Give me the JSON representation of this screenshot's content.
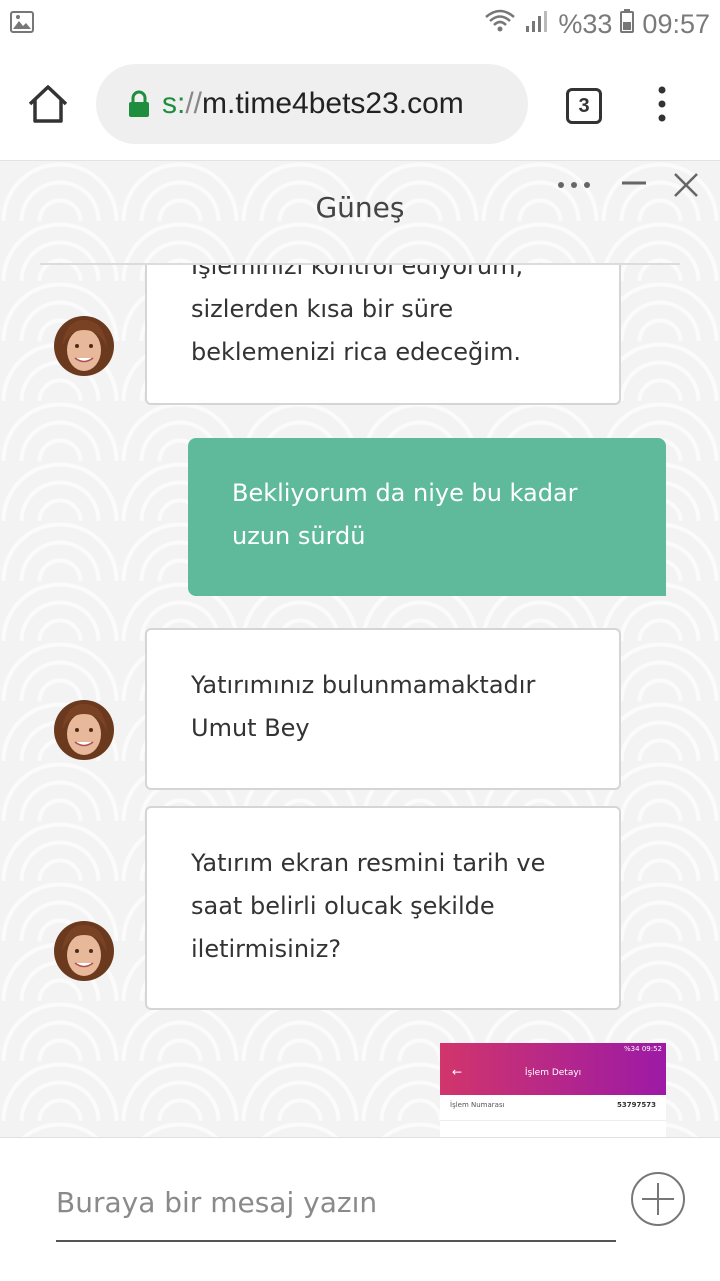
{
  "status_bar": {
    "battery": "%33",
    "time": "09:57"
  },
  "browser": {
    "url_scheme": "s:",
    "url_sep": "//",
    "url_host": "m.time4bets23.com",
    "tab_count": "3"
  },
  "chat": {
    "title": "Güneş",
    "messages": [
      {
        "from": "agent",
        "text": "İşleminizi kontrol ediyorum, sizlerden kısa bir süre beklemenizi rica edeceğim."
      },
      {
        "from": "user",
        "text": "Bekliyorum da niye bu kadar uzun sürdü"
      },
      {
        "from": "agent",
        "text": "Yatırımınız bulunmamaktadır Umut Bey"
      },
      {
        "from": "agent",
        "text": "Yatırım ekran resmini tarih ve saat belirli olucak şekilde iletirmisiniz?"
      }
    ],
    "attachment": {
      "status": "%34 09:52",
      "title": "İşlem Detayı",
      "row_label": "İşlem Numarası",
      "row_value": "53797573"
    }
  },
  "composer": {
    "placeholder": "Buraya bir mesaj yazın"
  },
  "colors": {
    "user_bubble": "#5fba9b",
    "secure_green": "#1e8e3e"
  }
}
